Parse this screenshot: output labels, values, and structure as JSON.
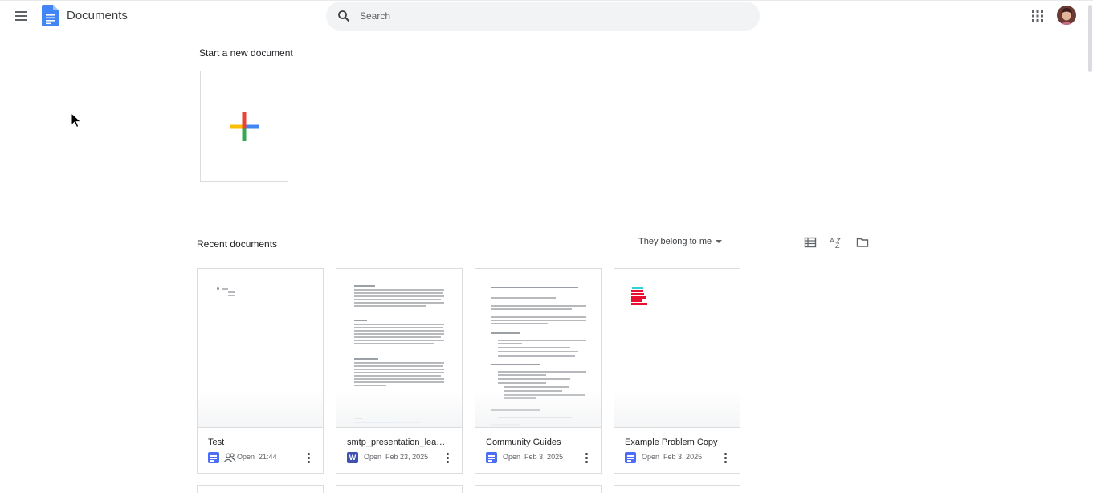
{
  "header": {
    "menu_icon": "hamburger-menu-icon",
    "logo_icon": "docs-logo-icon",
    "app_title": "Documents",
    "search_placeholder": "Search",
    "apps_icon": "google-apps-grid-icon",
    "avatar": "user-avatar"
  },
  "new_section": {
    "title": "Start a new document",
    "blank_icon": "colored-plus-icon"
  },
  "recent_section": {
    "title": "Recent documents",
    "owner_filter": "They belong to me",
    "view_toggle_icon": "list-view-icon",
    "sort_icon": "sort-az-icon",
    "folder_icon": "folder-picker-icon"
  },
  "documents": [
    {
      "name": "Test",
      "type": "google-doc",
      "shared": true,
      "open_label": "Open",
      "date": "21:44"
    },
    {
      "name": "smtp_presentation_leandro",
      "type": "word-doc",
      "shared": false,
      "open_label": "Open",
      "date": "Feb 23, 2025"
    },
    {
      "name": "Community Guides",
      "type": "google-doc",
      "shared": false,
      "open_label": "Open",
      "date": "Feb 3, 2025"
    },
    {
      "name": "Example Problem Copy",
      "type": "google-doc",
      "shared": false,
      "open_label": "Open",
      "date": "Feb 3, 2025"
    }
  ],
  "colors": {
    "blue": "#4285f4",
    "red": "#ea4335",
    "yellow": "#fbbc04",
    "green": "#34a853",
    "search_bg": "#f1f3f4",
    "border": "#dadce0"
  }
}
